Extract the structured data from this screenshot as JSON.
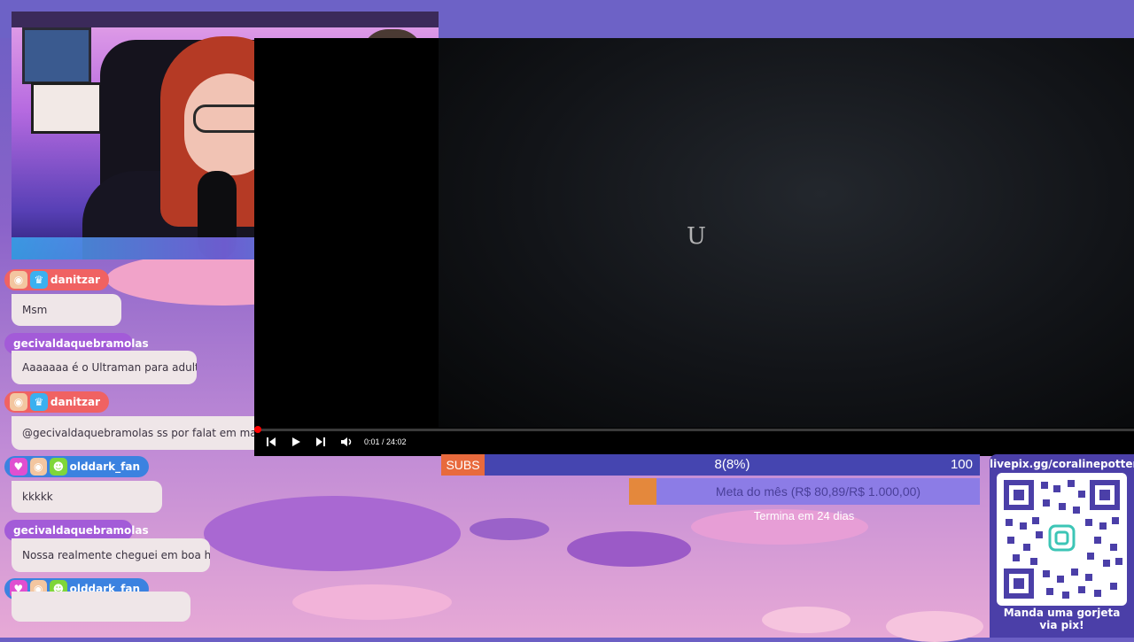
{
  "video": {
    "time": "0:01 / 24:02",
    "glyph": "U",
    "progress": 0.001
  },
  "chat": [
    {
      "user": "danitzar",
      "message": "Msm",
      "color": "#f06262"
    },
    {
      "user": "gecivaldaquebramolas",
      "message": "Aaaaaaa é o Ultraman para adultos",
      "color": "#a35bd8"
    },
    {
      "user": "danitzar",
      "message": "@gecivaldaquebramolas ss por falat em maduro e",
      "color": "#f06262"
    },
    {
      "user": "olddark_fan",
      "message": "kkkkk",
      "color": "#3b82e0"
    },
    {
      "user": "gecivaldaquebramolas",
      "message": "Nossa realmente cheguei em boa hora",
      "color": "#a35bd8"
    },
    {
      "user": "olddark_fan",
      "message": "",
      "color": "#3b82e0"
    }
  ],
  "subs": {
    "label": "SUBS",
    "count": "8(8%)",
    "goal": "100",
    "fraction": 0.08
  },
  "meta": {
    "label": "Meta do mês (R$ 80,89/R$ 1.000,00)",
    "subtitle": "Termina em 24 dias",
    "fraction": 0.08
  },
  "pix": {
    "url": "livepix.gg/coralinepotter",
    "cta": "Manda uma gorjeta via pix!"
  },
  "colors": {
    "topbar": "#6d62c6",
    "subs_accent": "#e86a3d",
    "meta_accent": "#e4883c"
  }
}
